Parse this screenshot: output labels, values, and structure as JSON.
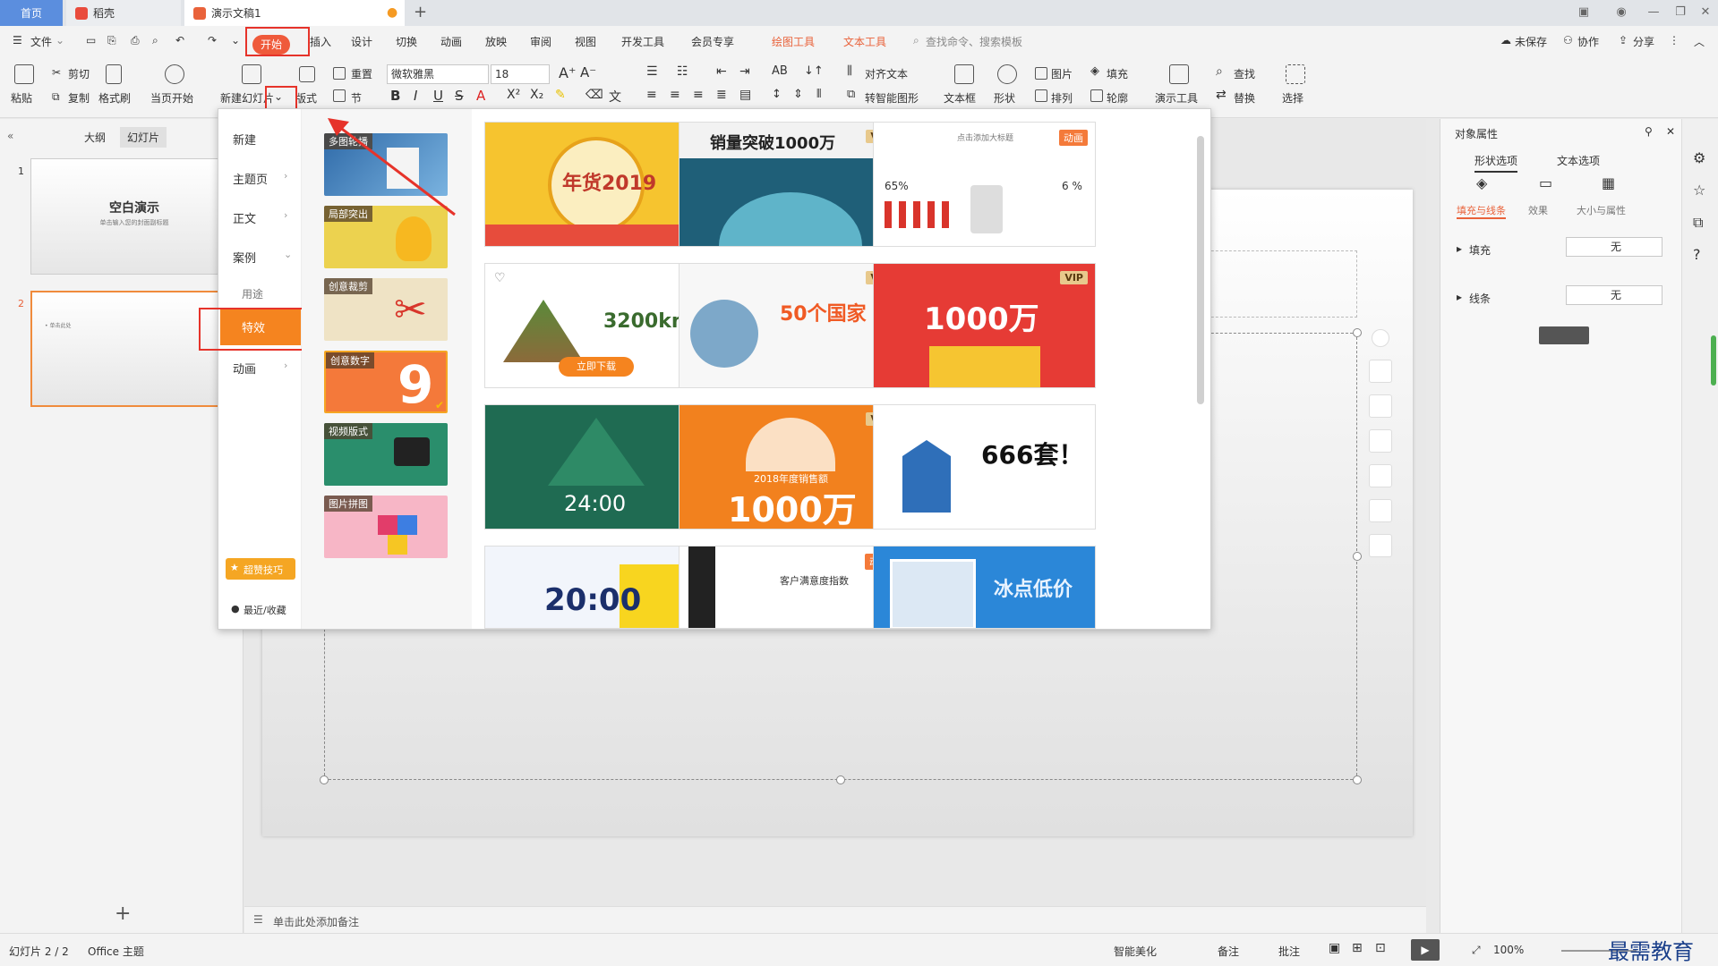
{
  "titlebar": {
    "tabs": [
      {
        "label": "首页"
      },
      {
        "label": "稻壳"
      },
      {
        "label": "演示文稿1"
      }
    ],
    "add_tab": "+"
  },
  "menu": {
    "file": "文件",
    "items": [
      "开始",
      "插入",
      "设计",
      "切换",
      "动画",
      "放映",
      "审阅",
      "视图",
      "开发工具",
      "会员专享"
    ],
    "tool_tabs": [
      "绘图工具",
      "文本工具"
    ],
    "search_placeholder": "查找命令、搜索模板",
    "right": [
      "未保存",
      "协作",
      "分享"
    ]
  },
  "ribbon": {
    "paste": "粘贴",
    "cut": "剪切",
    "copy": "复制",
    "format_painter": "格式刷",
    "play_from_current": "当页开始",
    "new_slide": "新建幻灯片",
    "layout": "版式",
    "section": "节",
    "reset": "重置",
    "font": "微软雅黑",
    "font_size": "18",
    "align_text": "对齐文本",
    "smart_art": "转智能图形",
    "textbox": "文本框",
    "shape": "形状",
    "picture": "图片",
    "arrange": "排列",
    "fill": "填充",
    "outline": "轮廓",
    "presentation_tools": "演示工具",
    "find": "查找",
    "replace": "替换",
    "select": "选择"
  },
  "leftpane": {
    "tabs": [
      "大纲",
      "幻灯片"
    ],
    "slides": [
      {
        "num": "1",
        "title": "空白演示",
        "subtitle": "单击输入您的封面副标题"
      },
      {
        "num": "2",
        "title": "",
        "subtitle": "• 单击此处"
      }
    ],
    "add": "+"
  },
  "dropdown": {
    "categories": [
      {
        "label": "新建",
        "chevron": ""
      },
      {
        "label": "主题页",
        "chevron": "›"
      },
      {
        "label": "正文",
        "chevron": "›"
      },
      {
        "label": "案例",
        "chevron": "⌄"
      },
      {
        "label": "用途",
        "chevron": ""
      },
      {
        "label": "特效",
        "chevron": ""
      },
      {
        "label": "动画",
        "chevron": "›"
      }
    ],
    "tips": "超赞技巧",
    "recent": "最近/收藏",
    "subcategories": [
      "多图轮播",
      "局部突出",
      "创意裁剪",
      "创意数字",
      "视频版式",
      "图片拼图"
    ],
    "cards": [
      {
        "text": "年货2019",
        "badge": ""
      },
      {
        "text": "销量突破1000万",
        "badge": "VIP"
      },
      {
        "text": "点击添加大标题",
        "badge": "动画"
      },
      {
        "text": "3200km²",
        "badge": "",
        "button": "立即下载"
      },
      {
        "text": "50个国家",
        "badge": "VIP"
      },
      {
        "text": "1000万",
        "badge": "VIP"
      },
      {
        "text": "24:00",
        "badge": ""
      },
      {
        "text": "1000万",
        "badge": "VIP",
        "sub": "2018年度销售额"
      },
      {
        "text": "666套！",
        "badge": ""
      },
      {
        "text": "20:00",
        "badge": ""
      },
      {
        "text": "客户满意度指数",
        "badge": "动画"
      },
      {
        "text": "冰点低价",
        "badge": ""
      }
    ],
    "card_extra": {
      "pct_left": "65%",
      "pct_right": "6 %"
    }
  },
  "notes": {
    "placeholder": "单击此处添加备注"
  },
  "rightpane": {
    "title": "对象属性",
    "tabs": [
      "形状选项",
      "文本选项"
    ],
    "subtabs": [
      "填充与线条",
      "效果",
      "大小与属性"
    ],
    "fill_label": "填充",
    "fill_value": "无",
    "line_label": "线条",
    "line_value": "无"
  },
  "statusbar": {
    "slide_info": "幻灯片 2 / 2",
    "theme": "Office 主题",
    "beautify": "智能美化",
    "notes": "备注",
    "comments": "批注",
    "zoom": "100%",
    "watermark": "最需教育"
  },
  "colors": {
    "accent": "#ef5a3b",
    "highlight": "#e6332a",
    "special_effect": "#f5841f",
    "home_tab": "#5b8ede"
  }
}
